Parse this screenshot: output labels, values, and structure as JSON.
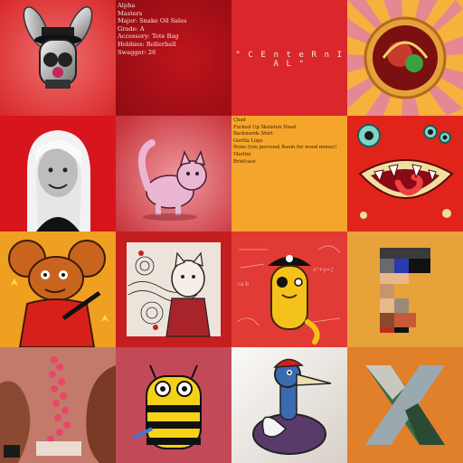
{
  "colors": {
    "tile_1": "#e23a35",
    "tile_2": "#a30e16",
    "tile_3": "#d9272c",
    "tile_4": "#f5b23d",
    "tile_5": "#d8141c",
    "tile_6": "#dc5a5e",
    "tile_7": "#f5a62a",
    "tile_8": "#e0241a",
    "tile_9": "#f0a020",
    "tile_10": "#c41e1e",
    "tile_11": "#e23a35",
    "tile_12": "#e8a23a",
    "tile_13": "#c47a6a",
    "tile_14": "#c24a58",
    "tile_15": "#f1ece8",
    "tile_16": "#e0802a",
    "text_light": "#f7e9e0",
    "text_dark": "#3a1a08"
  },
  "tiles": [
    {
      "id": 1,
      "kind": "art",
      "subject": "silver-bunny-tophat-icon"
    },
    {
      "id": 2,
      "kind": "text",
      "lines": [
        "Alpha",
        "Masters",
        "Major: Snake Oil Sales",
        "Grade: A",
        "Accessory: Tote Bag",
        "Hobbies: Rollerball",
        "Swagger: 26"
      ]
    },
    {
      "id": 3,
      "kind": "title",
      "text": "\" C E n t e R n I A L \""
    },
    {
      "id": 4,
      "kind": "art",
      "subject": "sunburst-medallion-icon"
    },
    {
      "id": 5,
      "kind": "art",
      "subject": "woman-portrait-icon"
    },
    {
      "id": 6,
      "kind": "art",
      "subject": "pink-cat-icon"
    },
    {
      "id": 7,
      "kind": "text",
      "lines": [
        "Chad",
        "Fucked Up Skeleton Head",
        "Backwards Shirt",
        "Gorilla Logo",
        "None (you personal Baum for wood money)",
        "Marlini",
        "Briefcase"
      ]
    },
    {
      "id": 8,
      "kind": "art",
      "subject": "monster-mouth-icon"
    },
    {
      "id": 9,
      "kind": "art",
      "subject": "cartoon-mouse-guitar-icon"
    },
    {
      "id": 10,
      "kind": "art",
      "subject": "ink-collage-cat-icon"
    },
    {
      "id": 11,
      "kind": "art",
      "subject": "pirate-cat-icon"
    },
    {
      "id": 12,
      "kind": "art",
      "subject": "pixel-figure-icon"
    },
    {
      "id": 13,
      "kind": "art",
      "subject": "pink-spheres-collage-icon"
    },
    {
      "id": 14,
      "kind": "art",
      "subject": "striped-bee-creature-icon"
    },
    {
      "id": 15,
      "kind": "art",
      "subject": "cartoon-duck-icon"
    },
    {
      "id": 16,
      "kind": "art",
      "subject": "x-logo-icon"
    }
  ]
}
